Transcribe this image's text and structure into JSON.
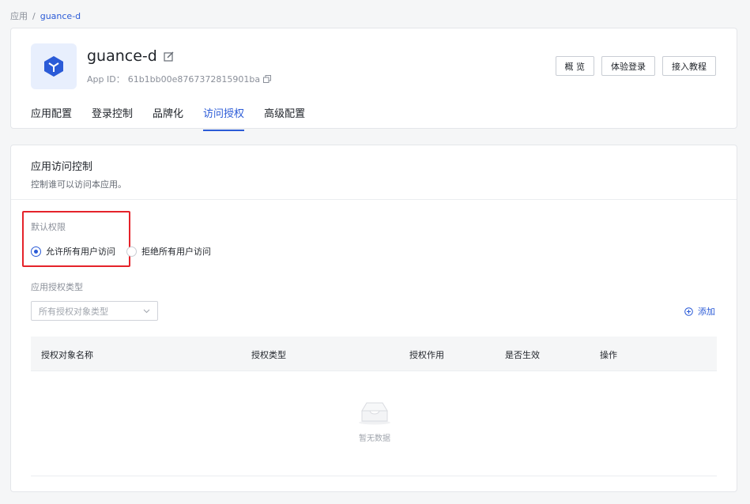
{
  "breadcrumb": {
    "root": "应用",
    "separator": "/",
    "current": "guance-d"
  },
  "app": {
    "name": "guance-d",
    "id_label": "App ID：",
    "id_value": "61b1bb00e8767372815901ba",
    "logo_icon": "cube-icon",
    "accent_color": "#2b5bd7"
  },
  "top_buttons": {
    "overview": "概 览",
    "trial_login": "体验登录",
    "integration_tutorial": "接入教程"
  },
  "tabs": [
    {
      "label": "应用配置",
      "active": false
    },
    {
      "label": "登录控制",
      "active": false
    },
    {
      "label": "品牌化",
      "active": false
    },
    {
      "label": "访问授权",
      "active": true
    },
    {
      "label": "高级配置",
      "active": false
    }
  ],
  "access_control": {
    "title": "应用访问控制",
    "description": "控制谁可以访问本应用。",
    "default_permission_label": "默认权限",
    "radio_options": [
      {
        "label": "允许所有用户访问",
        "checked": true
      },
      {
        "label": "拒绝所有用户访问",
        "checked": false
      }
    ],
    "auth_type_label": "应用授权类型",
    "select_placeholder": "所有授权对象类型",
    "add_label": "添加"
  },
  "table": {
    "columns": [
      "授权对象名称",
      "授权类型",
      "授权作用",
      "是否生效",
      "操作"
    ],
    "empty_text": "暂无数据"
  }
}
